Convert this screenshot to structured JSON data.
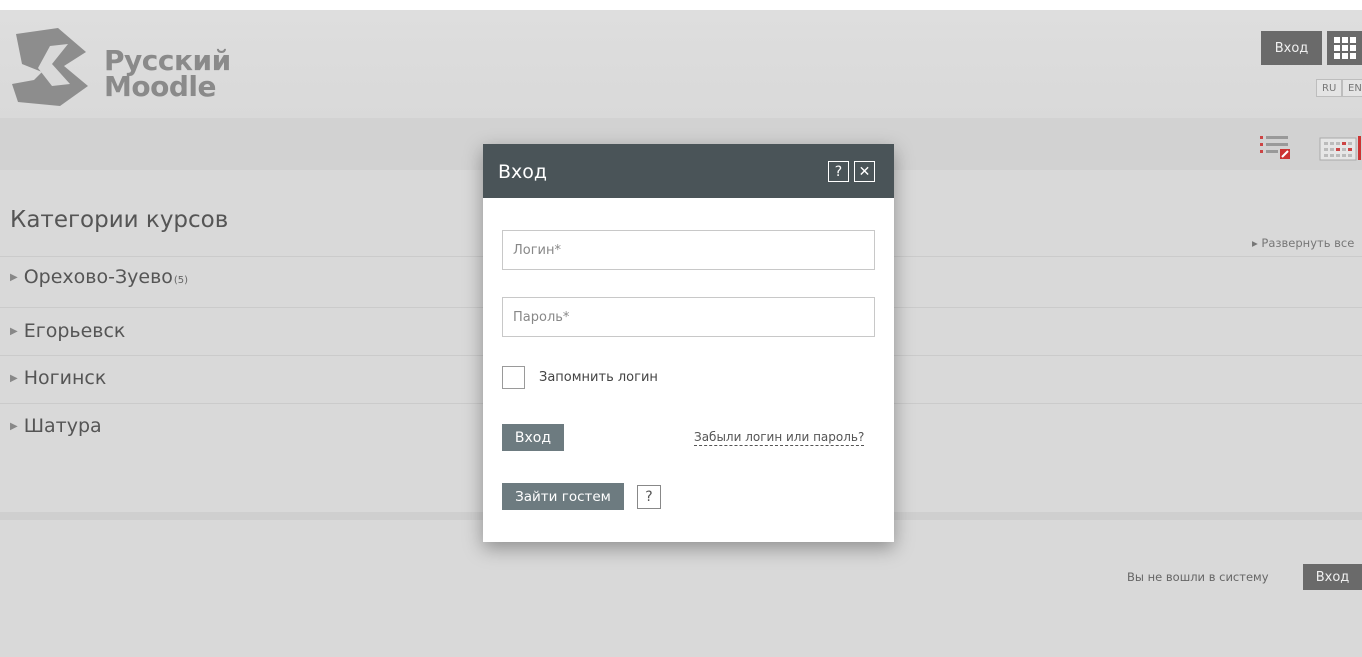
{
  "header": {
    "logo_text_line1": "Русский",
    "logo_text_line2": "Moodle",
    "login_label": "Вход",
    "lang_ru": "RU",
    "lang_en": "EN"
  },
  "icons": {
    "grid": "grid-icon",
    "list": "list-icon",
    "calendar": "calendar-icon"
  },
  "main": {
    "title": "Категории курсов",
    "expand_all": "▸ Развернуть все",
    "categories": [
      {
        "label": "Орехово-Зуево",
        "count": "(5)"
      },
      {
        "label": "Егорьевск",
        "count": ""
      },
      {
        "label": "Ногинск",
        "count": ""
      },
      {
        "label": "Шатура",
        "count": ""
      }
    ]
  },
  "footer": {
    "not_logged_text": "Вы не вошли в систему",
    "login_label": "Вход"
  },
  "modal": {
    "title": "Вход",
    "help_glyph": "?",
    "close_glyph": "✕",
    "login_placeholder": "Логин*",
    "password_placeholder": "Пароль*",
    "remember_label": "Запомнить логин",
    "login_button": "Вход",
    "forgot_link": "Забыли логин или пароль?",
    "guest_button": "Зайти гостем",
    "guest_help_glyph": "?"
  },
  "colors": {
    "modal_header": "#4a5458",
    "button_primary": "#6d7b80",
    "header_button": "#6a6a6a",
    "background": "#d9d9d9"
  }
}
